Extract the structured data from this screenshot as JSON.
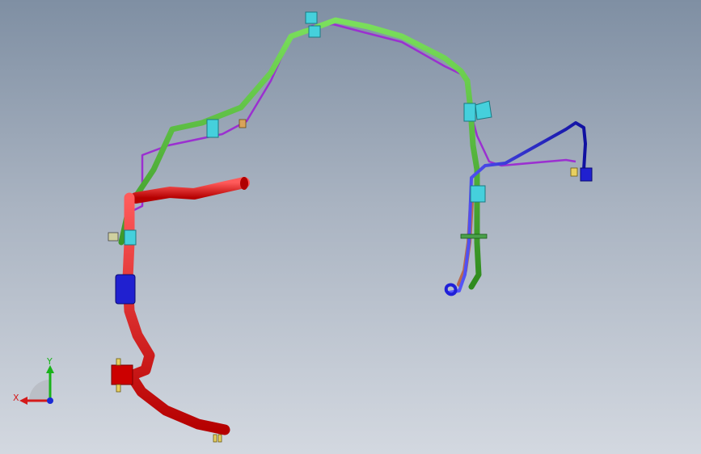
{
  "viewport": {
    "name": "cad-3d-viewport",
    "background_top": "#7f8fa3",
    "background_bottom": "#d3d8e0"
  },
  "model": {
    "pipe_colors": {
      "green_line": "#3fa52b",
      "purple_line": "#9b30d0",
      "red_hose": "#e01010",
      "blue_line": "#2020d8",
      "copper_section": "#b86a50",
      "clip": "#45d0dc"
    }
  },
  "triad": {
    "x_label": "X",
    "y_label": "Y",
    "x_color": "#d41a1a",
    "y_color": "#19b21a",
    "z_color": "#1a2ad4"
  }
}
